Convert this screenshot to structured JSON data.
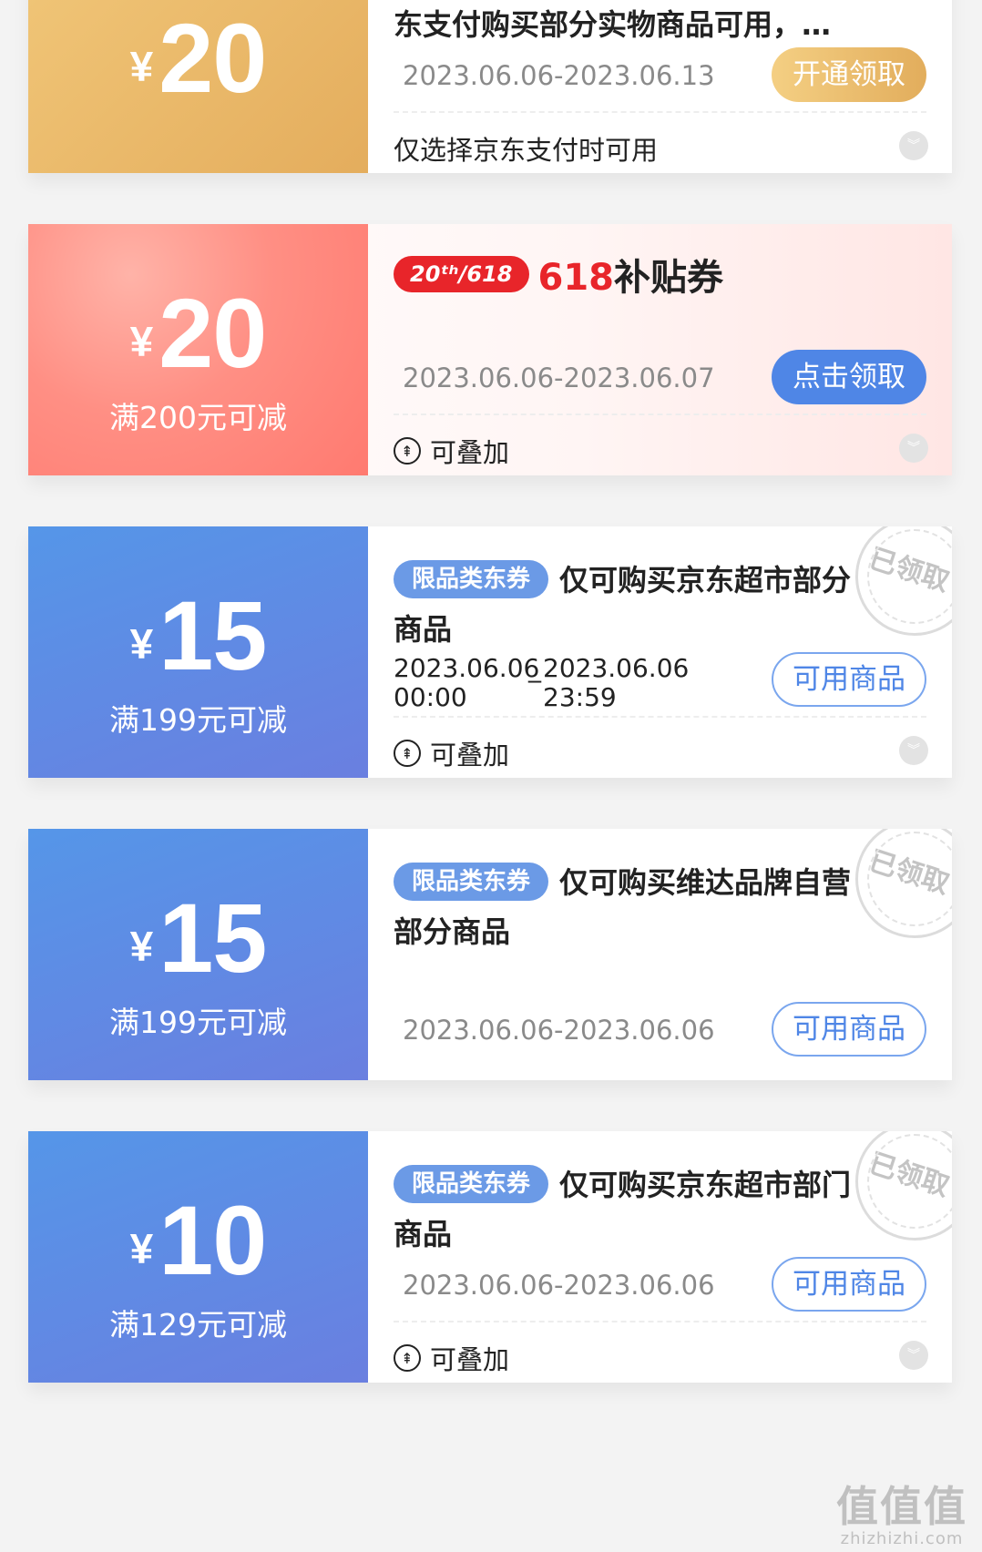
{
  "coupons": [
    {
      "currency": "¥",
      "amount": "20",
      "title_partial": "东支付购买部分实物商品可用，…",
      "date": "2023.06.06-2023.06.13",
      "button": "开通领取",
      "note": "仅选择京东支付时可用"
    },
    {
      "currency": "¥",
      "amount": "20",
      "condition": "满200元可减",
      "badge": "20ᵗʰ/618",
      "badge_prefix": "618",
      "badge_text": "补贴券",
      "date": "2023.06.06-2023.06.07",
      "button": "点击领取",
      "note": "可叠加"
    },
    {
      "currency": "¥",
      "amount": "15",
      "condition": "满199元可减",
      "tag": "限品类东券",
      "title": "仅可购买京东超市部分商品",
      "date_start": "2023.06.06 00:00",
      "date_sep": "_",
      "date_end": "2023.06.06 23:59",
      "button": "可用商品",
      "note": "可叠加",
      "stamp": "已领取"
    },
    {
      "currency": "¥",
      "amount": "15",
      "condition": "满199元可减",
      "tag": "限品类东券",
      "title": "仅可购买维达品牌自营部分商品",
      "date": "2023.06.06-2023.06.06",
      "button": "可用商品",
      "stamp": "已领取"
    },
    {
      "currency": "¥",
      "amount": "10",
      "condition": "满129元可减",
      "tag": "限品类东券",
      "title": "仅可购买京东超市部门商品",
      "date": "2023.06.06-2023.06.06",
      "button": "可用商品",
      "note": "可叠加",
      "stamp": "已领取"
    }
  ],
  "watermark": {
    "big": "值值值",
    "small": "zhizhizhi.com"
  },
  "colors": {
    "gold": "#e4ad5d",
    "pink": "#ff8f84",
    "blue": "#5f8ae4",
    "accent_red": "#e8252a"
  }
}
